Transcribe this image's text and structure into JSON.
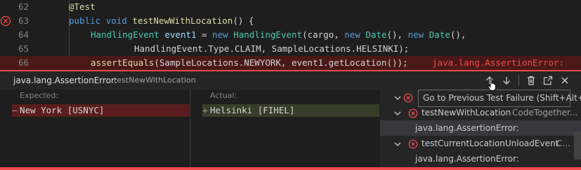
{
  "editor": {
    "lines": [
      {
        "number": "62",
        "error": false
      },
      {
        "number": "63",
        "error": true
      },
      {
        "number": "64",
        "error": false
      },
      {
        "number": "65",
        "error": false
      },
      {
        "number": "66",
        "error": false
      }
    ],
    "code": {
      "l62_annotation": "@Test",
      "l63_public": "public",
      "l63_void": "void",
      "l63_method": "testNewWithLocation",
      "l63_rest": "() {",
      "l64_type": "HandlingEvent",
      "l64_var": "event1",
      "l64_eq": " = ",
      "l64_new1": "new",
      "l64_ctor": "HandlingEvent",
      "l64_args1": "(cargo, ",
      "l64_new2": "new",
      "l64_date1": "Date",
      "l64_args2": "(), ",
      "l64_new3": "new",
      "l64_date2": "Date",
      "l64_args3": "(),",
      "l65_text": "HandlingEvent.Type.CLAIM, SampleLocations.HELSINKI);",
      "l66_assert": "assertEquals",
      "l66_args": "(SampleLocations.NEWYORK, event1.getLocation());",
      "l66_inline_error": "java.lang.AssertionError:"
    }
  },
  "peek": {
    "title": "java.lang.AssertionError:",
    "subtitle": "testNewWithLocation",
    "expected_label": "Expected:",
    "actual_label": "Actual:",
    "removed_mark": "—",
    "expected_value": "New York [USNYC]",
    "added_mark": "+",
    "actual_value": "Helsinki [FIHEL]",
    "actions": [
      "arrow-up-icon",
      "arrow-down-icon",
      "trash-icon",
      "open-external-icon",
      "close-icon"
    ]
  },
  "tree": {
    "test1_name": "testNewWithLocation",
    "test1_desc": "CodeTogether...",
    "test1_msg": "java.lang.AssertionError:",
    "test2_name": "testCurrentLocationUnloadEvent",
    "test2_desc": "C...",
    "test2_msg": "java.lang.AssertionError:"
  },
  "tooltip": {
    "text": "Go to Previous Test Failure (Shift+Alt+F8)"
  },
  "colors": {
    "error": "#f14c4c",
    "editor_bg": "#1e1e1e",
    "panel_bg": "#252526"
  }
}
